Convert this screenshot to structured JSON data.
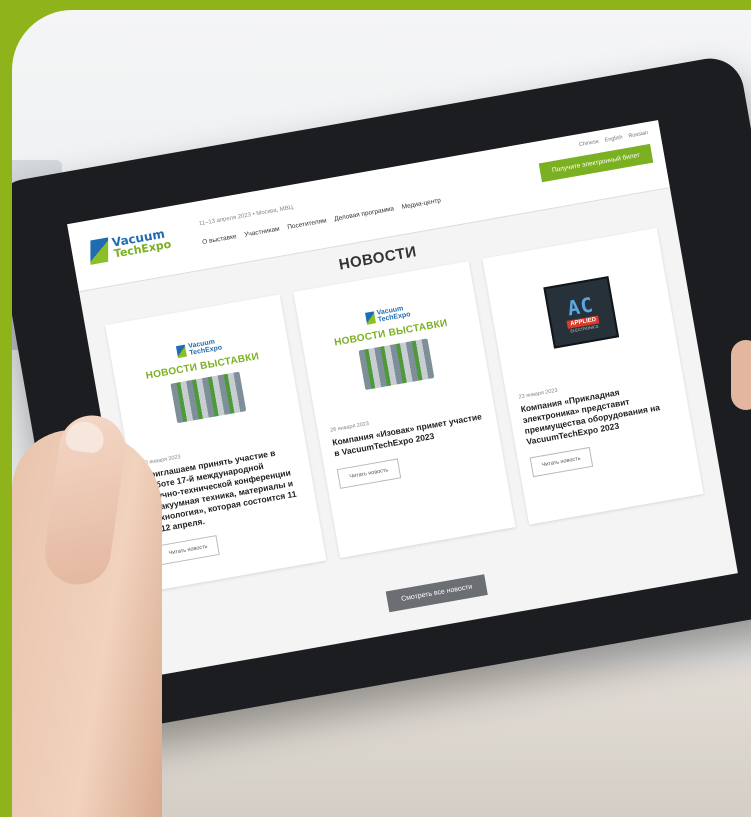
{
  "site": {
    "logo_line1": "Vacuum",
    "logo_line2": "TechExpo",
    "date_line": "11–13 апреля 2023 • Москва, МВЦ",
    "langs": [
      "Chinese",
      "English",
      "Russian"
    ],
    "ticket_button": "Получите электронный билет",
    "nav": [
      "О выставке",
      "Участникам",
      "Посетителям",
      "Деловая программа",
      "Медиа-центр"
    ]
  },
  "page": {
    "title": "НОВОСТИ",
    "all_news_button": "Смотреть все новости"
  },
  "cards": [
    {
      "banner": "НОВОСТИ ВЫСТАВКИ",
      "date": "30 января 2023",
      "headline": "Приглашаем принять участие в работе 17-й международной научно-технической конференции «Вакуумная техника, материалы и технология», которая состоится 11 и 12 апреля.",
      "read_more": "Читать новость"
    },
    {
      "banner": "НОВОСТИ ВЫСТАВКИ",
      "date": "26 января 2023",
      "headline": "Компания «Изовак» примет участие в VacuumTechExpo 2023",
      "read_more": "Читать новость"
    },
    {
      "logo_ac": "AC",
      "logo_applied": "APPLIED",
      "logo_electronics": "ELECTRONICS",
      "date": "23 января 2023",
      "headline": "Компания «Прикладная электроника» представит преимущества оборудования на VacuumTechExpo 2023",
      "read_more": "Читать новость"
    }
  ],
  "colors": {
    "accent_green": "#7bb023",
    "brand_blue": "#1f6db0",
    "frame_green": "#8fb31a"
  }
}
